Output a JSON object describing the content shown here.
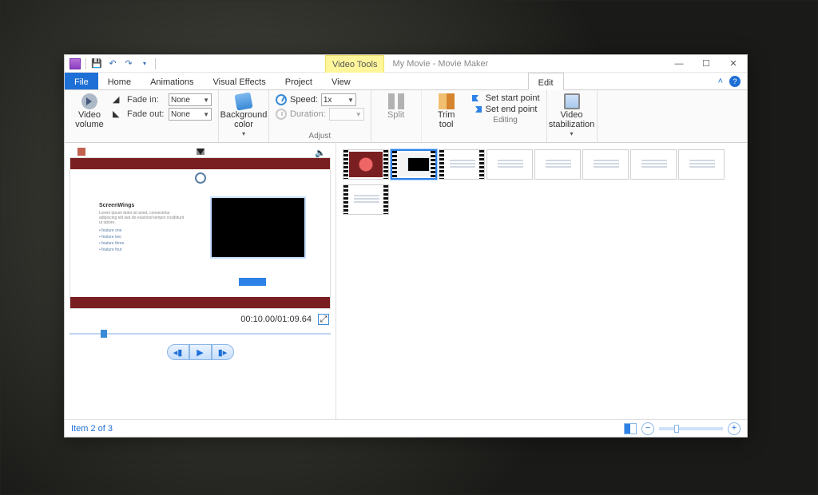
{
  "window": {
    "context_tab": "Video Tools",
    "title": "My Movie - Movie Maker"
  },
  "tabs": {
    "file": "File",
    "home": "Home",
    "animations": "Animations",
    "visual_effects": "Visual Effects",
    "project": "Project",
    "view": "View",
    "edit": "Edit"
  },
  "ribbon": {
    "audio": {
      "video_volume": "Video\nvolume",
      "fade_in": "Fade in:",
      "fade_out": "Fade out:",
      "fade_in_val": "None",
      "fade_out_val": "None"
    },
    "bgcolor": "Background\ncolor",
    "speed_label": "Speed:",
    "speed_val": "1x",
    "duration_label": "Duration:",
    "duration_val": "",
    "adjust_group": "Adjust",
    "split": "Split",
    "trim": "Trim\ntool",
    "set_start": "Set start point",
    "set_end": "Set end point",
    "editing_group": "Editing",
    "stabilization": "Video\nstabilization"
  },
  "preview": {
    "heading": "ScreenWings",
    "time": "00:10.00/01:09.64"
  },
  "status": {
    "item": "Item 2 of 3"
  }
}
